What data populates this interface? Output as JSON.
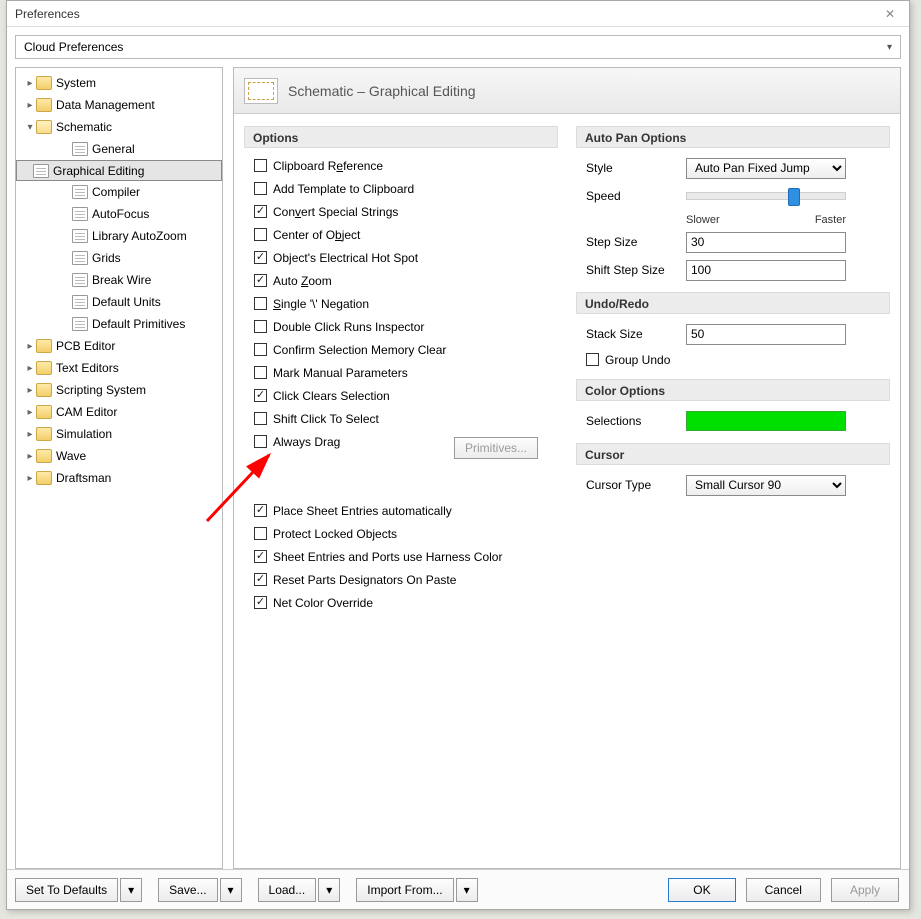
{
  "window": {
    "title": "Preferences",
    "close_glyph": "✕"
  },
  "cloudbar": {
    "label": "Cloud Preferences",
    "dd_glyph": "▾"
  },
  "tree": {
    "top": [
      {
        "k": "system",
        "label": "System",
        "expanded": false
      },
      {
        "k": "datamgmt",
        "label": "Data Management",
        "expanded": false
      },
      {
        "k": "schematic",
        "label": "Schematic",
        "expanded": true
      }
    ],
    "schematic_children": [
      {
        "k": "general",
        "label": "General"
      },
      {
        "k": "gedit",
        "label": "Graphical Editing",
        "selected": true
      },
      {
        "k": "compiler",
        "label": "Compiler"
      },
      {
        "k": "autofocus",
        "label": "AutoFocus"
      },
      {
        "k": "libzoom",
        "label": "Library AutoZoom"
      },
      {
        "k": "grids",
        "label": "Grids"
      },
      {
        "k": "breakwire",
        "label": "Break Wire"
      },
      {
        "k": "defunits",
        "label": "Default Units"
      },
      {
        "k": "defprim",
        "label": "Default Primitives"
      }
    ],
    "tail": [
      {
        "k": "pcb",
        "label": "PCB Editor"
      },
      {
        "k": "texted",
        "label": "Text Editors"
      },
      {
        "k": "scripting",
        "label": "Scripting System"
      },
      {
        "k": "cam",
        "label": "CAM Editor"
      },
      {
        "k": "sim",
        "label": "Simulation"
      },
      {
        "k": "wave",
        "label": "Wave"
      },
      {
        "k": "draftsman",
        "label": "Draftsman"
      }
    ]
  },
  "header": {
    "title": "Schematic – Graphical Editing"
  },
  "options": {
    "section": "Options",
    "items1": [
      {
        "k": "clipref",
        "checked": false,
        "text": "Clipboard Reference",
        "u": "e"
      },
      {
        "k": "addtpl",
        "checked": false,
        "text": "Add Template to Clipboard"
      },
      {
        "k": "convspec",
        "checked": true,
        "text": "Convert Special Strings",
        "u": "v"
      },
      {
        "k": "centerobj",
        "checked": false,
        "text": "Center of Object",
        "u": "b"
      },
      {
        "k": "hotspot",
        "checked": true,
        "text": "Object's Electrical Hot Spot",
        "u": "j"
      },
      {
        "k": "autozoom",
        "checked": true,
        "text": "Auto Zoom",
        "u": "Z"
      },
      {
        "k": "singleneg",
        "checked": false,
        "text": "Single '\\' Negation",
        "u": "S"
      },
      {
        "k": "dblclick",
        "checked": false,
        "text": "Double Click Runs Inspector"
      },
      {
        "k": "confirmsel",
        "checked": false,
        "text": "Confirm Selection Memory Clear"
      },
      {
        "k": "markman",
        "checked": false,
        "text": "Mark Manual Parameters"
      },
      {
        "k": "clickclr",
        "checked": true,
        "text": "Click Clears Selection"
      },
      {
        "k": "shiftclk",
        "checked": false,
        "text": "Shift Click To Select"
      },
      {
        "k": "alwaysdrag",
        "checked": false,
        "text": "Always Drag"
      }
    ],
    "primitives_btn": "Primitives...",
    "items2": [
      {
        "k": "placesheet",
        "checked": true,
        "text": "Place Sheet Entries automatically"
      },
      {
        "k": "protlock",
        "checked": false,
        "text": "Protect Locked Objects"
      },
      {
        "k": "harnessclr",
        "checked": true,
        "text": "Sheet Entries and Ports use Harness Color"
      },
      {
        "k": "resetdes",
        "checked": true,
        "text": "Reset Parts Designators On Paste"
      },
      {
        "k": "netcolor",
        "checked": true,
        "text": "Net Color Override"
      }
    ]
  },
  "autopan": {
    "section": "Auto Pan Options",
    "style_label": "Style",
    "style_value": "Auto Pan Fixed Jump",
    "speed_label": "Speed",
    "speed_pos_pct": 68,
    "slower": "Slower",
    "faster": "Faster",
    "step_label": "Step Size",
    "step_value": "30",
    "shift_label": "Shift Step Size",
    "shift_value": "100"
  },
  "undo": {
    "section": "Undo/Redo",
    "stack_label": "Stack Size",
    "stack_value": "50",
    "group_undo": {
      "checked": false,
      "text": "Group Undo"
    }
  },
  "coloropt": {
    "section": "Color Options",
    "sel_label": "Selections",
    "sel_color": "#00e000"
  },
  "cursor": {
    "section": "Cursor",
    "type_label": "Cursor Type",
    "type_value": "Small Cursor 90"
  },
  "footer": {
    "defaults": "Set To Defaults",
    "save": "Save...",
    "load": "Load...",
    "import": "Import From...",
    "ok": "OK",
    "cancel": "Cancel",
    "apply": "Apply",
    "dd_glyph": "▾"
  }
}
